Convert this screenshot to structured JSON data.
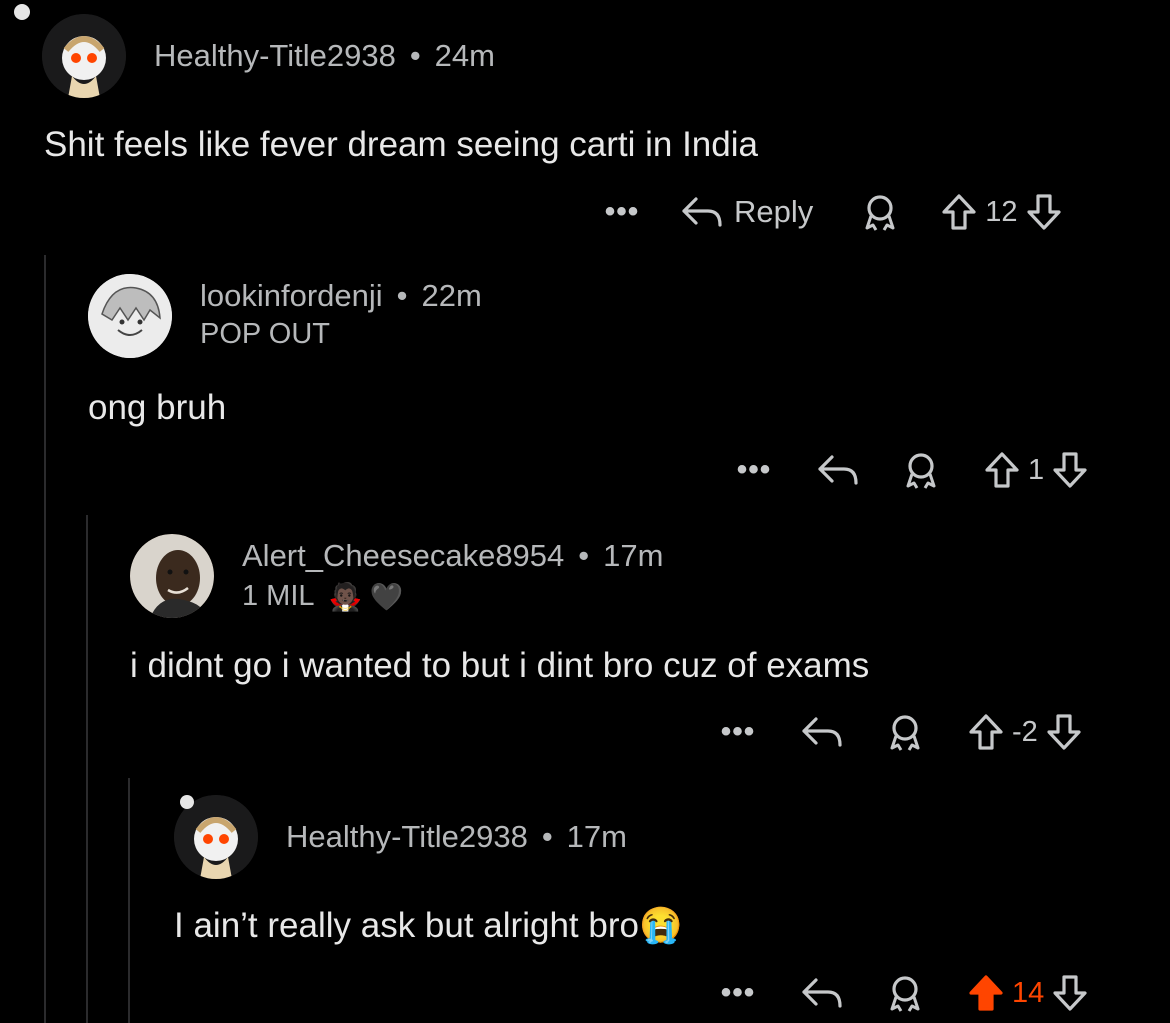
{
  "comments": [
    {
      "username": "Healthy-Title2938",
      "time": "24m",
      "body": "Shit feels like fever dream seeing carti in India",
      "actions": {
        "more": "•••",
        "reply_label": "Reply",
        "score": "12",
        "upvoted": false
      }
    },
    {
      "username": "lookinfordenji",
      "time": "22m",
      "flair": "POP OUT",
      "body": "ong bruh",
      "actions": {
        "more": "•••",
        "score": "1",
        "upvoted": false
      }
    },
    {
      "username": "Alert_Cheesecake8954",
      "time": "17m",
      "flair": "1 MIL",
      "flair_emoji": "🧛🏿 🖤",
      "body": "i didnt go i wanted to but i dint bro cuz of exams",
      "actions": {
        "more": "•••",
        "score": "-2",
        "upvoted": false
      }
    },
    {
      "username": "Healthy-Title2938",
      "time": "17m",
      "body": "I ain’t really ask but alright bro😭",
      "actions": {
        "more": "•••",
        "score": "14",
        "upvoted": true
      }
    }
  ],
  "dot": "•",
  "colors": {
    "background": "#000000",
    "text": "#e8e8e8",
    "meta": "#b6b8ba",
    "upvote_active": "#ff4500"
  }
}
